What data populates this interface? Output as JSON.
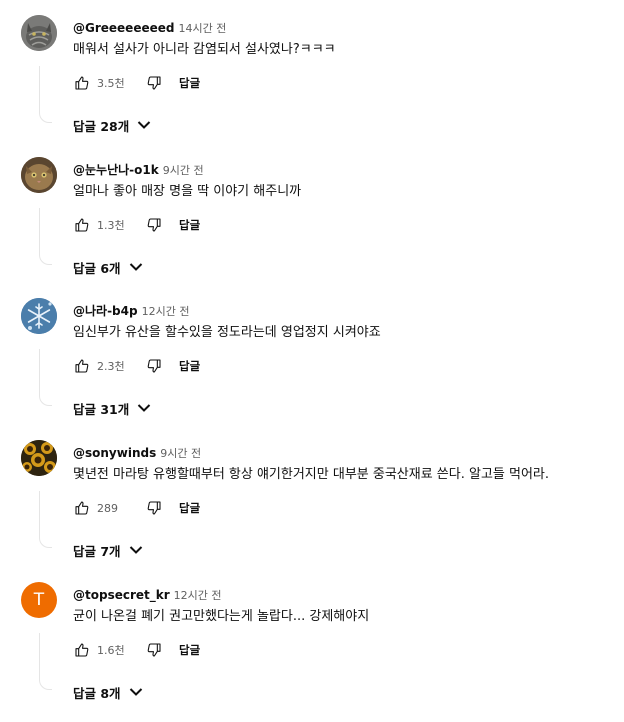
{
  "comments": [
    {
      "author": "@Greeeeeeeed",
      "time": "14시간 전",
      "text": "매워서 설사가 아니라 감염되서 설사였나?ㅋㅋㅋ",
      "likes": "3.5천",
      "reply_label": "답글",
      "replies_label": "답글 28개",
      "avatar_icon": "cat-photo-avatar"
    },
    {
      "author": "@눈누난나-o1k",
      "time": "9시간 전",
      "text": "얼마나 좋아 매장 명을 딱 이야기 해주니까",
      "likes": "1.3천",
      "reply_label": "답글",
      "replies_label": "답글 6개",
      "avatar_icon": "cat-face-avatar"
    },
    {
      "author": "@나라-b4p",
      "time": "12시간 전",
      "text": "임신부가 유산을 할수있을 정도라는데 영업정지 시켜야죠",
      "likes": "2.3천",
      "reply_label": "답글",
      "replies_label": "답글 31개",
      "avatar_icon": "snowflake-avatar"
    },
    {
      "author": "@sonywinds",
      "time": "9시간 전",
      "text": "몇년전 마라탕 유행할때부터 항상 얘기한거지만 대부분 중국산재료 쓴다. 알고들 먹어라.",
      "likes": "289",
      "reply_label": "답글",
      "replies_label": "답글 7개",
      "avatar_icon": "sunflowers-avatar"
    },
    {
      "author": "@topsecret_kr",
      "time": "12시간 전",
      "text": "균이 나온걸 폐기 권고만했다는게 놀랍다... 강제해야지",
      "likes": "1.6천",
      "reply_label": "답글",
      "replies_label": "답글 8개",
      "avatar_letter": "T",
      "avatar_color": "#ef6c00"
    }
  ]
}
